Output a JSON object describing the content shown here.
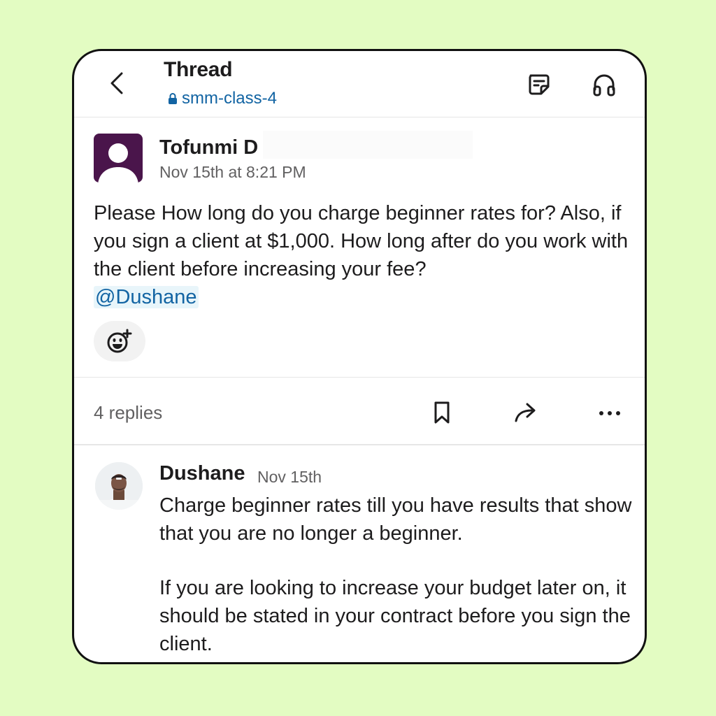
{
  "header": {
    "title": "Thread",
    "channel": "smm-class-4"
  },
  "post": {
    "author": "Tofunmi D",
    "timestamp": "Nov 15th at 8:21 PM",
    "text": "Please How long do you charge beginner rates for? Also, if you sign a client at $1,000. How long after do you work with the client before increasing your fee?",
    "mention": "@Dushane"
  },
  "actions": {
    "replies_count": "4 replies"
  },
  "reply": {
    "author": "Dushane",
    "timestamp": "Nov 15th",
    "paragraphs": [
      "Charge beginner rates till you have results that show that you are no longer a beginner.",
      "If you are looking to increase your budget later on, it should be stated in your contract before you sign the client."
    ]
  },
  "icons": [
    "back-icon",
    "lock-icon",
    "canvas-note-icon",
    "headphone-icon",
    "add-reaction-icon",
    "bookmark-icon",
    "share-icon",
    "more-icon"
  ],
  "colors": {
    "background": "#e3fcc2",
    "link": "#1264a3",
    "avatar_bg": "#4a154b",
    "muted_text": "#616061"
  }
}
